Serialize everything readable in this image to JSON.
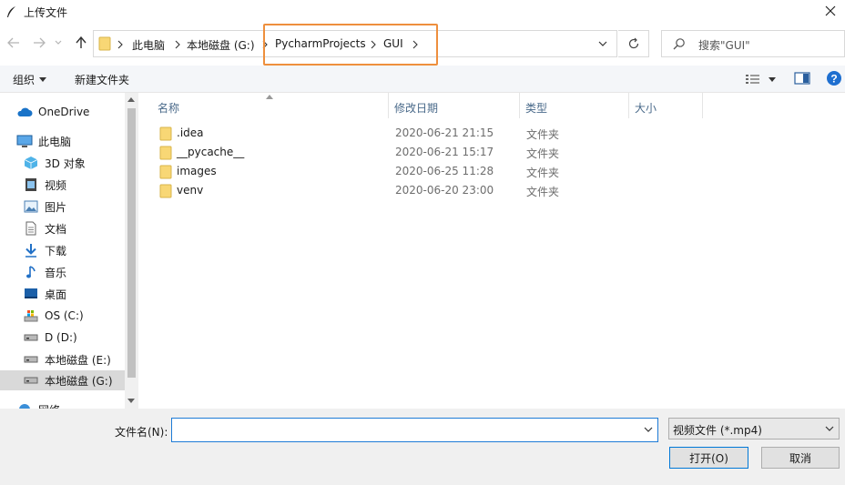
{
  "window": {
    "title": "上传文件"
  },
  "address": {
    "crumbs": [
      "此电脑",
      "本地磁盘 (G:)",
      "PycharmProjects",
      "GUI"
    ]
  },
  "search": {
    "placeholder": "搜索\"GUI\""
  },
  "toolbar": {
    "organize_label": "组织",
    "new_folder_label": "新建文件夹"
  },
  "nav": {
    "items": [
      {
        "label": "OneDrive",
        "icon": "cloud-icon"
      },
      {
        "label": "此电脑",
        "icon": "computer-icon"
      },
      {
        "label": "3D 对象",
        "icon": "cube-icon"
      },
      {
        "label": "视频",
        "icon": "video-icon"
      },
      {
        "label": "图片",
        "icon": "picture-icon"
      },
      {
        "label": "文档",
        "icon": "document-icon"
      },
      {
        "label": "下载",
        "icon": "download-icon"
      },
      {
        "label": "音乐",
        "icon": "music-icon"
      },
      {
        "label": "桌面",
        "icon": "desktop-icon"
      },
      {
        "label": "OS (C:)",
        "icon": "system-drive-icon"
      },
      {
        "label": "D (D:)",
        "icon": "drive-icon"
      },
      {
        "label": "本地磁盘 (E:)",
        "icon": "drive-icon"
      },
      {
        "label": "本地磁盘 (G:)",
        "icon": "drive-icon"
      },
      {
        "label": "网络",
        "icon": "network-icon"
      }
    ]
  },
  "columns": {
    "name": "名称",
    "modified": "修改日期",
    "type": "类型",
    "size": "大小"
  },
  "files": [
    {
      "name": ".idea",
      "modified": "2020-06-21 21:15",
      "type": "文件夹"
    },
    {
      "name": "__pycache__",
      "modified": "2020-06-21 15:17",
      "type": "文件夹"
    },
    {
      "name": "images",
      "modified": "2020-06-25 11:28",
      "type": "文件夹"
    },
    {
      "name": "venv",
      "modified": "2020-06-20 23:00",
      "type": "文件夹"
    }
  ],
  "bottom": {
    "filename_label": "文件名(N):",
    "filename_value": "",
    "filetype_value": "视频文件 (*.mp4)",
    "open_label": "打开(O)",
    "cancel_label": "取消"
  },
  "colors": {
    "accent": "#0078d7",
    "highlight_border": "#ee8f3d",
    "folder": "#f8d775"
  }
}
